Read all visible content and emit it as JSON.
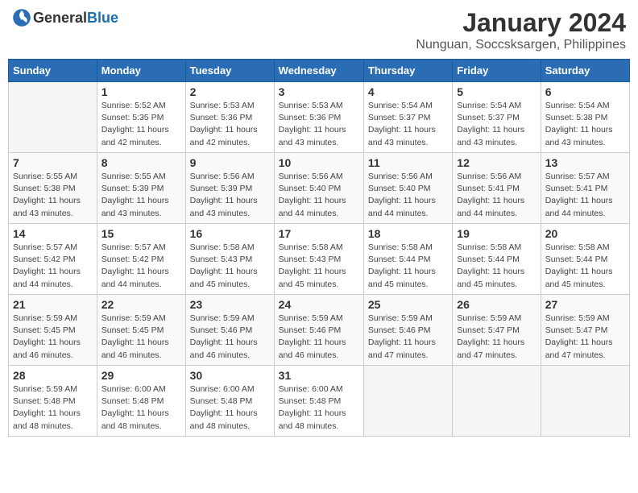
{
  "header": {
    "logo_general": "General",
    "logo_blue": "Blue",
    "month_year": "January 2024",
    "location": "Nunguan, Soccsksargen, Philippines"
  },
  "days_of_week": [
    "Sunday",
    "Monday",
    "Tuesday",
    "Wednesday",
    "Thursday",
    "Friday",
    "Saturday"
  ],
  "weeks": [
    [
      {
        "day": "",
        "info": ""
      },
      {
        "day": "1",
        "info": "Sunrise: 5:52 AM\nSunset: 5:35 PM\nDaylight: 11 hours\nand 42 minutes."
      },
      {
        "day": "2",
        "info": "Sunrise: 5:53 AM\nSunset: 5:36 PM\nDaylight: 11 hours\nand 42 minutes."
      },
      {
        "day": "3",
        "info": "Sunrise: 5:53 AM\nSunset: 5:36 PM\nDaylight: 11 hours\nand 43 minutes."
      },
      {
        "day": "4",
        "info": "Sunrise: 5:54 AM\nSunset: 5:37 PM\nDaylight: 11 hours\nand 43 minutes."
      },
      {
        "day": "5",
        "info": "Sunrise: 5:54 AM\nSunset: 5:37 PM\nDaylight: 11 hours\nand 43 minutes."
      },
      {
        "day": "6",
        "info": "Sunrise: 5:54 AM\nSunset: 5:38 PM\nDaylight: 11 hours\nand 43 minutes."
      }
    ],
    [
      {
        "day": "7",
        "info": "Sunrise: 5:55 AM\nSunset: 5:38 PM\nDaylight: 11 hours\nand 43 minutes."
      },
      {
        "day": "8",
        "info": "Sunrise: 5:55 AM\nSunset: 5:39 PM\nDaylight: 11 hours\nand 43 minutes."
      },
      {
        "day": "9",
        "info": "Sunrise: 5:56 AM\nSunset: 5:39 PM\nDaylight: 11 hours\nand 43 minutes."
      },
      {
        "day": "10",
        "info": "Sunrise: 5:56 AM\nSunset: 5:40 PM\nDaylight: 11 hours\nand 44 minutes."
      },
      {
        "day": "11",
        "info": "Sunrise: 5:56 AM\nSunset: 5:40 PM\nDaylight: 11 hours\nand 44 minutes."
      },
      {
        "day": "12",
        "info": "Sunrise: 5:56 AM\nSunset: 5:41 PM\nDaylight: 11 hours\nand 44 minutes."
      },
      {
        "day": "13",
        "info": "Sunrise: 5:57 AM\nSunset: 5:41 PM\nDaylight: 11 hours\nand 44 minutes."
      }
    ],
    [
      {
        "day": "14",
        "info": "Sunrise: 5:57 AM\nSunset: 5:42 PM\nDaylight: 11 hours\nand 44 minutes."
      },
      {
        "day": "15",
        "info": "Sunrise: 5:57 AM\nSunset: 5:42 PM\nDaylight: 11 hours\nand 44 minutes."
      },
      {
        "day": "16",
        "info": "Sunrise: 5:58 AM\nSunset: 5:43 PM\nDaylight: 11 hours\nand 45 minutes."
      },
      {
        "day": "17",
        "info": "Sunrise: 5:58 AM\nSunset: 5:43 PM\nDaylight: 11 hours\nand 45 minutes."
      },
      {
        "day": "18",
        "info": "Sunrise: 5:58 AM\nSunset: 5:44 PM\nDaylight: 11 hours\nand 45 minutes."
      },
      {
        "day": "19",
        "info": "Sunrise: 5:58 AM\nSunset: 5:44 PM\nDaylight: 11 hours\nand 45 minutes."
      },
      {
        "day": "20",
        "info": "Sunrise: 5:58 AM\nSunset: 5:44 PM\nDaylight: 11 hours\nand 45 minutes."
      }
    ],
    [
      {
        "day": "21",
        "info": "Sunrise: 5:59 AM\nSunset: 5:45 PM\nDaylight: 11 hours\nand 46 minutes."
      },
      {
        "day": "22",
        "info": "Sunrise: 5:59 AM\nSunset: 5:45 PM\nDaylight: 11 hours\nand 46 minutes."
      },
      {
        "day": "23",
        "info": "Sunrise: 5:59 AM\nSunset: 5:46 PM\nDaylight: 11 hours\nand 46 minutes."
      },
      {
        "day": "24",
        "info": "Sunrise: 5:59 AM\nSunset: 5:46 PM\nDaylight: 11 hours\nand 46 minutes."
      },
      {
        "day": "25",
        "info": "Sunrise: 5:59 AM\nSunset: 5:46 PM\nDaylight: 11 hours\nand 47 minutes."
      },
      {
        "day": "26",
        "info": "Sunrise: 5:59 AM\nSunset: 5:47 PM\nDaylight: 11 hours\nand 47 minutes."
      },
      {
        "day": "27",
        "info": "Sunrise: 5:59 AM\nSunset: 5:47 PM\nDaylight: 11 hours\nand 47 minutes."
      }
    ],
    [
      {
        "day": "28",
        "info": "Sunrise: 5:59 AM\nSunset: 5:48 PM\nDaylight: 11 hours\nand 48 minutes."
      },
      {
        "day": "29",
        "info": "Sunrise: 6:00 AM\nSunset: 5:48 PM\nDaylight: 11 hours\nand 48 minutes."
      },
      {
        "day": "30",
        "info": "Sunrise: 6:00 AM\nSunset: 5:48 PM\nDaylight: 11 hours\nand 48 minutes."
      },
      {
        "day": "31",
        "info": "Sunrise: 6:00 AM\nSunset: 5:48 PM\nDaylight: 11 hours\nand 48 minutes."
      },
      {
        "day": "",
        "info": ""
      },
      {
        "day": "",
        "info": ""
      },
      {
        "day": "",
        "info": ""
      }
    ]
  ]
}
